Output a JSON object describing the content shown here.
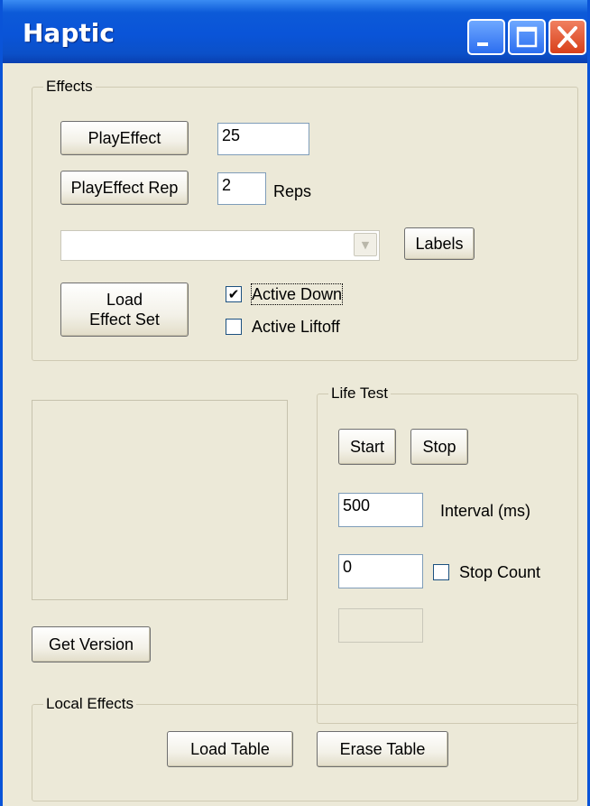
{
  "window": {
    "title": "Haptic"
  },
  "effects": {
    "group_label": "Effects",
    "play_effect_label": "PlayEffect",
    "effect_value": "25",
    "play_effect_rep_label": "PlayEffect Rep",
    "reps_value": "2",
    "reps_label": "Reps",
    "combo_value": "",
    "labels_button": "Labels",
    "load_effect_set_label": "Load\nEffect Set",
    "active_down_label": "Active Down",
    "active_down_checked": true,
    "active_liftoff_label": "Active Liftoff",
    "active_liftoff_checked": false
  },
  "get_version_label": "Get Version",
  "life_test": {
    "group_label": "Life Test",
    "start_label": "Start",
    "stop_label": "Stop",
    "interval_value": "500",
    "interval_label": "Interval (ms)",
    "stop_count_value": "0",
    "stop_count_label": "Stop Count",
    "stop_count_checked": false,
    "status_value": ""
  },
  "local_effects": {
    "group_label": "Local Effects",
    "load_table_label": "Load Table",
    "erase_table_label": "Erase Table"
  },
  "colors": {
    "face": "#ece9d8",
    "title_blue": "#0a54d8",
    "close_red": "#d8401a"
  },
  "icons": {
    "minimize": "minimize-icon",
    "maximize": "maximize-icon",
    "close": "close-icon"
  }
}
